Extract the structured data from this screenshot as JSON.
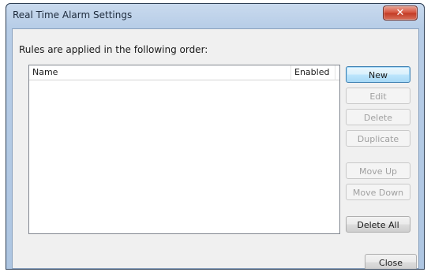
{
  "window": {
    "title": "Real Time Alarm Settings",
    "close_glyph": "✕"
  },
  "rules_label": "Rules are applied in the following order:",
  "list": {
    "columns": [
      "Name",
      "Enabled"
    ],
    "rows": []
  },
  "buttons": {
    "new": "New",
    "edit": "Edit",
    "delete": "Delete",
    "duplicate": "Duplicate",
    "move_up": "Move Up",
    "move_down": "Move Down",
    "delete_all": "Delete All",
    "close": "Close"
  },
  "icons": {
    "close": "close-icon"
  }
}
